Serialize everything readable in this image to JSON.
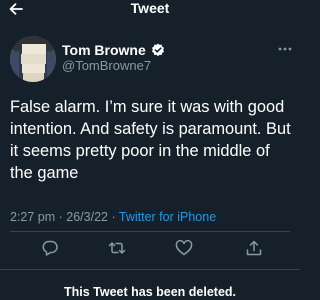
{
  "header": {
    "title": "Tweet"
  },
  "author": {
    "name": "Tom Browne",
    "handle": "@TomBrowne7"
  },
  "tweet": {
    "text": "False alarm. I’m sure it was with good intention. And safety is paramount. But it seems pretty poor in the middle of the game",
    "time": "2:27 pm",
    "separator": " · ",
    "date": "26/3/22",
    "source": "Twitter for iPhone"
  },
  "notice": "This Tweet has been deleted.",
  "icons": {
    "back": "arrow-left",
    "verified": "verified-badge",
    "more": "ellipsis",
    "reply": "speech-bubble",
    "retweet": "retweet-arrows",
    "like": "heart",
    "share": "share-arrow"
  },
  "colors": {
    "background": "#15202b",
    "text": "#ffffff",
    "secondary": "#8899a6",
    "accent": "#1d9bf0",
    "divider": "#38444d"
  }
}
